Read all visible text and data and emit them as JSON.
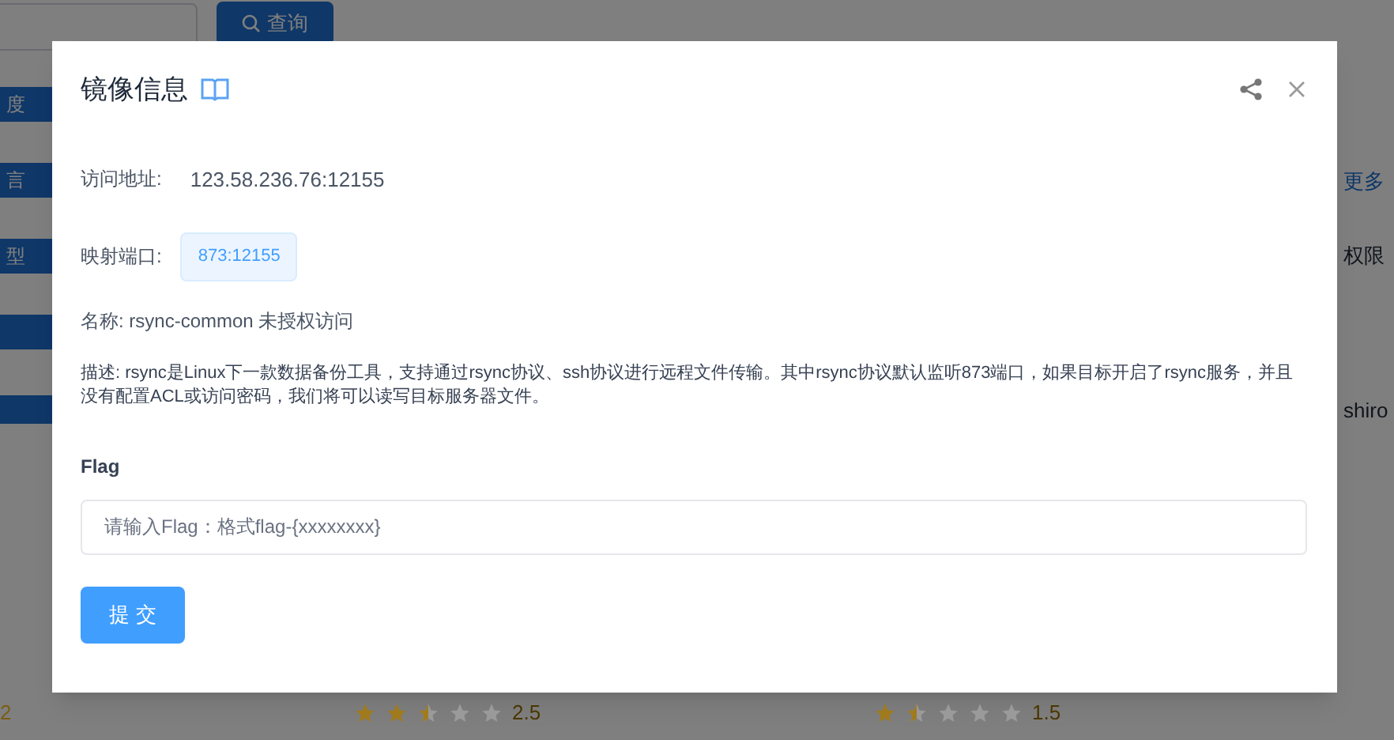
{
  "background": {
    "search_button": "查询",
    "side_tags": [
      "度",
      "言",
      "型"
    ],
    "right_texts": [
      {
        "text": "更多",
        "kind": "link"
      },
      {
        "text": "权限",
        "kind": "plain"
      },
      {
        "text": "shiro",
        "kind": "plain"
      }
    ],
    "ratings": [
      {
        "stars": 2.5,
        "score": "2.5"
      },
      {
        "stars": 1.5,
        "score": "1.5"
      }
    ],
    "left_score": "2"
  },
  "dialog": {
    "title": "镜像信息",
    "address_label": "访问地址:",
    "address": "123.58.236.76:12155",
    "port_label": "映射端口:",
    "port": "873:12155",
    "name": "名称: rsync-common 未授权访问",
    "description": "描述: rsync是Linux下一款数据备份工具，支持通过rsync协议、ssh协议进行远程文件传输。其中rsync协议默认监听873端口，如果目标开启了rsync服务，并且没有配置ACL或访问密码，我们将可以读写目标服务器文件。",
    "flag_label": "Flag",
    "flag_placeholder": "请输入Flag：格式flag-{xxxxxxxx}",
    "submit": "提 交"
  }
}
